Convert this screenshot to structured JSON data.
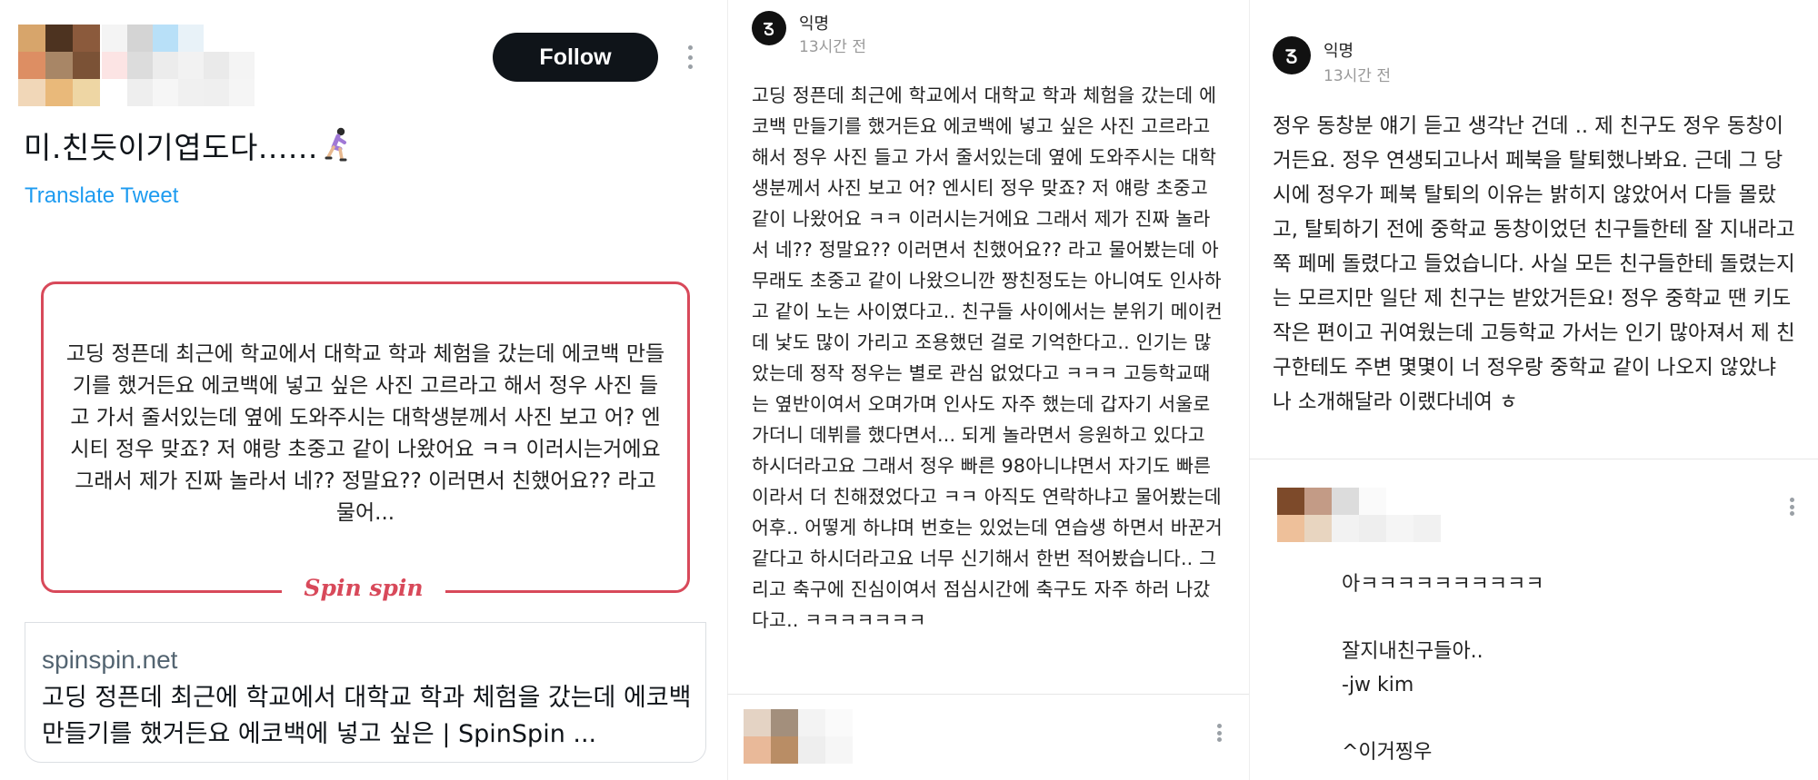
{
  "tweet": {
    "follow_label": "Follow",
    "text": "미.친듯이기엽도다......",
    "emoji": "person-running",
    "translate_label": "Translate Tweet",
    "card": {
      "image_text": "고딩 정픈데 최근에 학교에서 대학교 학과 체험을 갔는데 에코백 만들기를 했거든요 에코백에 넣고 싶은 사진 고르라고 해서 정우 사진 들고 가서 줄서있는데 옆에 도와주시는 대학생분께서 사진 보고 어? 엔시티 정우 맞죠? 저 얘랑 초중고 같이 나왔어요 ㅋㅋ 이러시는거에요 그래서 제가 진짜 놀라서 네?? 정말요?? 이러면서 친했어요?? 라고 물어...",
      "brand": "Spin spin",
      "domain": "spinspin.net",
      "title": "고딩 정픈데 최근에 학교에서 대학교 학과 체험을 갔는데 에코백 만들기를 했거든요 에코백에 넣고 싶은 | SpinSpin ..."
    }
  },
  "post_middle": {
    "author": "익명",
    "time": "13시간 전",
    "body": "고딩 정픈데 최근에 학교에서 대학교 학과 체험을 갔는데 에코백 만들기를 했거든요 에코백에 넣고 싶은 사진 고르라고 해서 정우 사진 들고 가서 줄서있는데 옆에 도와주시는 대학생분께서 사진 보고 어? 엔시티 정우 맞죠? 저 얘랑 초중고 같이 나왔어요 ㅋㅋ 이러시는거에요 그래서 제가 진짜 놀라서 네?? 정말요?? 이러면서 친했어요?? 라고 물어봤는데 아무래도 초중고 같이 나왔으니깐 짱친정도는 아니여도 인사하고 같이 노는 사이였다고.. 친구들 사이에서는 분위기 메이컨데 낯도 많이 가리고 조용했던 걸로 기억한다고.. 인기는 많았는데 정작 정우는 별로 관심 없었다고 ㅋㅋㅋ 고등학교때는 옆반이여서 오며가며 인사도 자주 했는데 갑자기 서울로 가더니 데뷔를 했다면서... 되게 놀라면서 응원하고 있다고 하시더라고요 그래서 정우 빠른 98아니냐면서 자기도 빠른이라서 더 친해졌었다고 ㅋㅋ 아직도 연락하냐고 물어봤는데 어후.. 어떻게 하냐며 번호는 있었는데 연습생 하면서 바꾼거 같다고 하시더라고요 너무 신기해서 한번 적어봤습니다.. 그리고 축구에 진심이여서 점심시간에 축구도 자주 하러 나갔다고.. ㅋㅋㅋㅋㅋㅋㅋ"
  },
  "post_right": {
    "author": "익명",
    "time": "13시간 전",
    "body": "정우 동창분 얘기 듣고 생각난 건데 .. 제 친구도 정우 동창이거든요. 정우 연생되고나서 페북을 탈퇴했나봐요. 근데 그 당시에 정우가 페북 탈퇴의 이유는 밝히지 않았어서 다들 몰랐고, 탈퇴하기 전에 중학교 동창이었던 친구들한테 잘 지내라고 쭉 페메 돌렸다고 들었습니다. 사실 모든 친구들한테 돌렸는지는 모르지만 일단 제 친구는 받았거든요! 정우 중학교 땐 키도 작은 편이고 귀여웠는데 고등학교 가서는 인기 많아져서 제 친구한테도 주변 몇몇이 너 정우랑 중학교 같이 나오지 않았냐 나 소개해달라 이랬다네여 ㅎ",
    "reply": "아ㅋㅋㅋㅋㅋㅋㅋㅋㅋㅋ\n\n잘지내친구들아..\n-jw kim\n\n^이거찡우"
  },
  "colors": {
    "twitter_blue": "#1d9bf0",
    "brand_red": "#d8495a",
    "follow_bg": "#0f1419"
  }
}
